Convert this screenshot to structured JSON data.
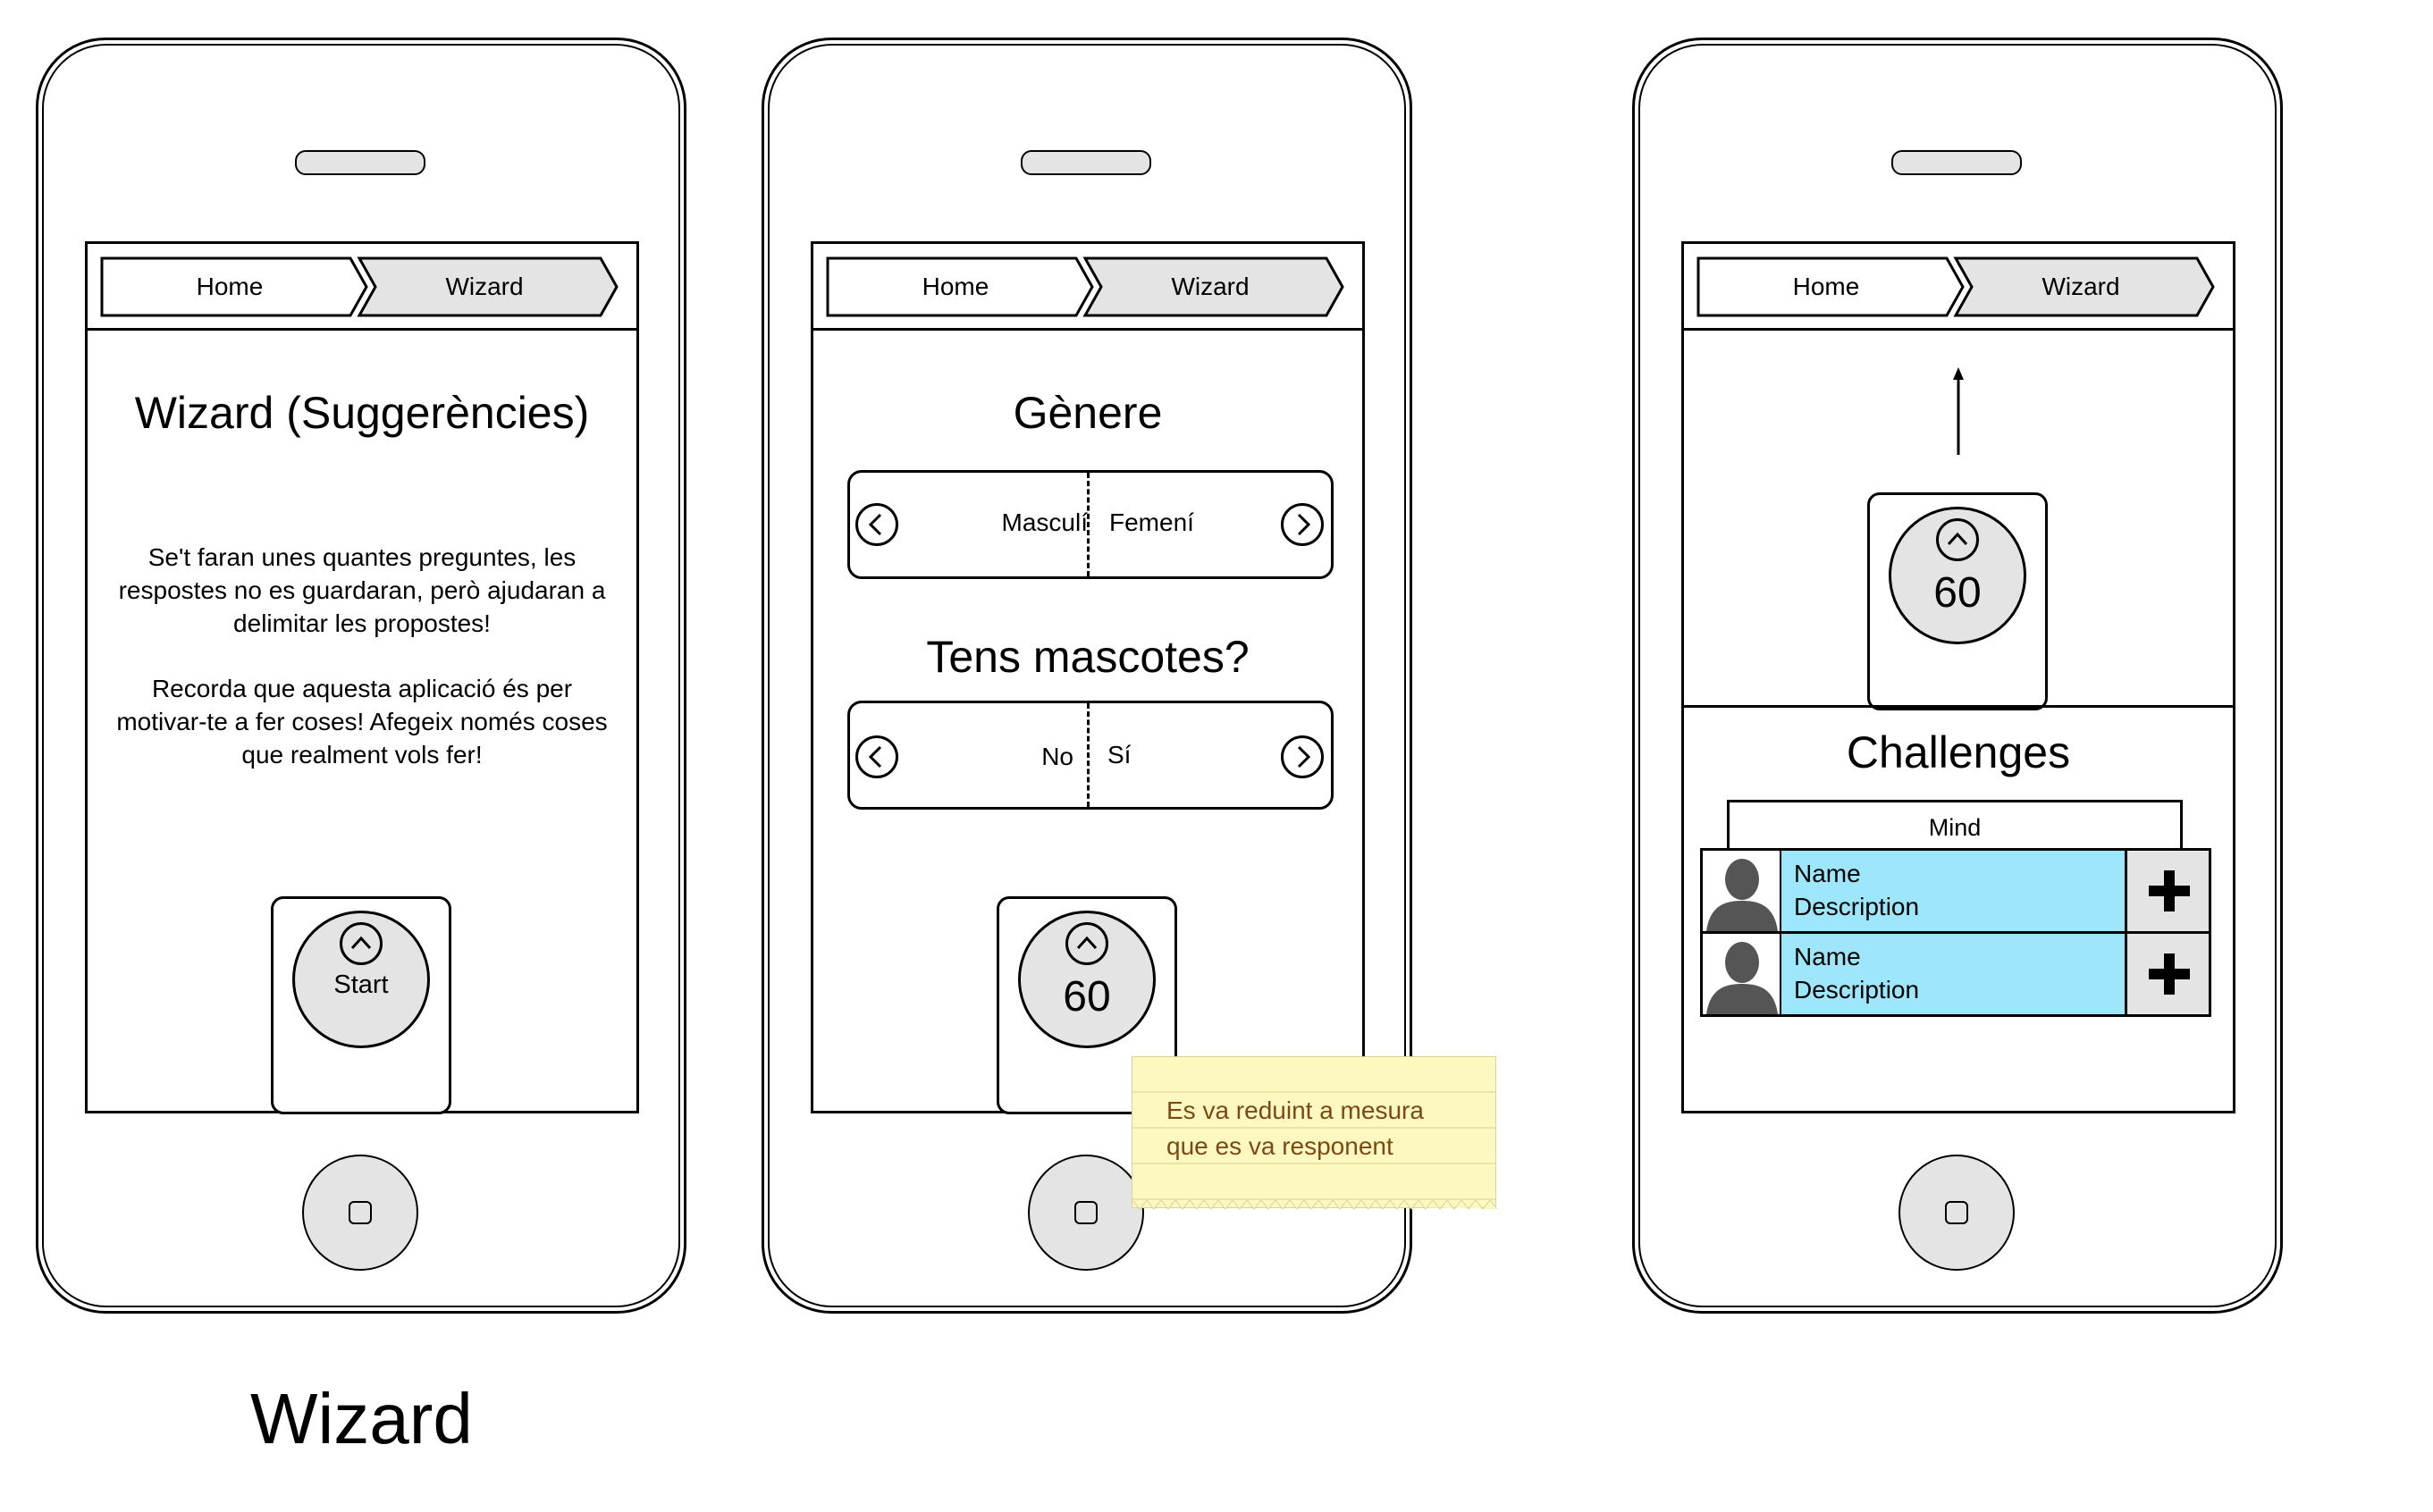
{
  "breadcrumb": {
    "home": "Home",
    "current": "Wizard"
  },
  "screen1": {
    "title": "Wizard (Suggerències)",
    "paragraph1": [
      "Se't faran unes quantes preguntes, les",
      "respostes no es guardaran, però ajudaran a",
      "delimitar les propostes!"
    ],
    "paragraph2": [
      "Recorda que aquesta aplicació és per",
      "motivar-te a fer coses! Afegeix només coses",
      "que realment vols fer!"
    ],
    "start_label": "Start"
  },
  "screen2": {
    "q1": {
      "title": "Gènere",
      "left": "Masculí",
      "right": "Femení"
    },
    "q2": {
      "title": "Tens mascotes?",
      "left": "No",
      "right": "Sí"
    },
    "counter": "60",
    "note": [
      "Es va reduint a mesura",
      "que es va responent"
    ]
  },
  "screen3": {
    "counter": "60",
    "section_title": "Challenges",
    "tab_label": "Mind",
    "items": [
      {
        "name": "Name",
        "description": "Description"
      },
      {
        "name": "Name",
        "description": "Description"
      }
    ]
  },
  "caption": "Wizard",
  "colors": {
    "row_fill": "#9de6fb",
    "note_fill": "#fdf8bf",
    "knob_fill": "#e4e4e4"
  }
}
